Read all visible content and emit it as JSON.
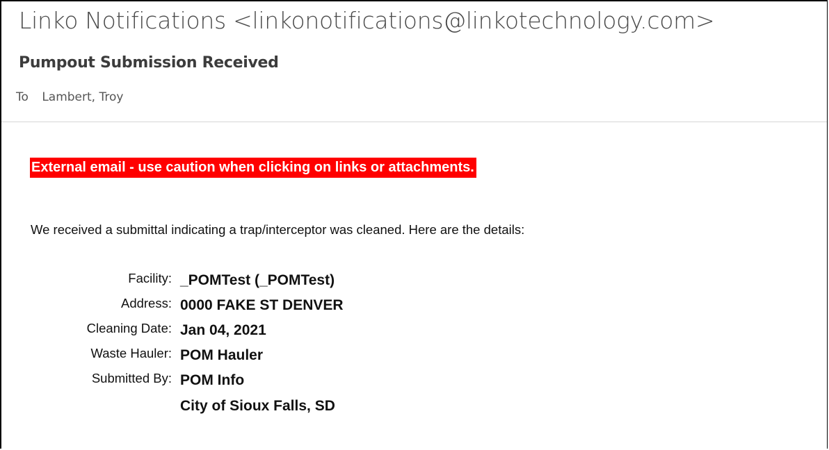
{
  "email": {
    "sender": "Linko Notifications <linkonotifications@linkotechnology.com>",
    "subject": "Pumpout Submission Received",
    "to_label": "To",
    "to_value": "Lambert, Troy"
  },
  "body": {
    "banner": "External email - use caution when clicking on links or attachments.",
    "intro": "We received a submittal indicating a trap/interceptor was cleaned. Here are the details:",
    "details": [
      {
        "label": "Facility:",
        "value": "_POMTest (_POMTest)"
      },
      {
        "label": "Address:",
        "value": "0000 FAKE ST DENVER"
      },
      {
        "label": "Cleaning Date:",
        "value": "Jan 04, 2021"
      },
      {
        "label": "Waste Hauler:",
        "value": "POM Hauler"
      },
      {
        "label": "Submitted By:",
        "value": "POM Info",
        "value_line2": "City of Sioux Falls, SD"
      }
    ]
  },
  "colors": {
    "banner_bg": "#ff0000",
    "banner_text": "#ffffff",
    "header_text": "#4a4a4a"
  }
}
